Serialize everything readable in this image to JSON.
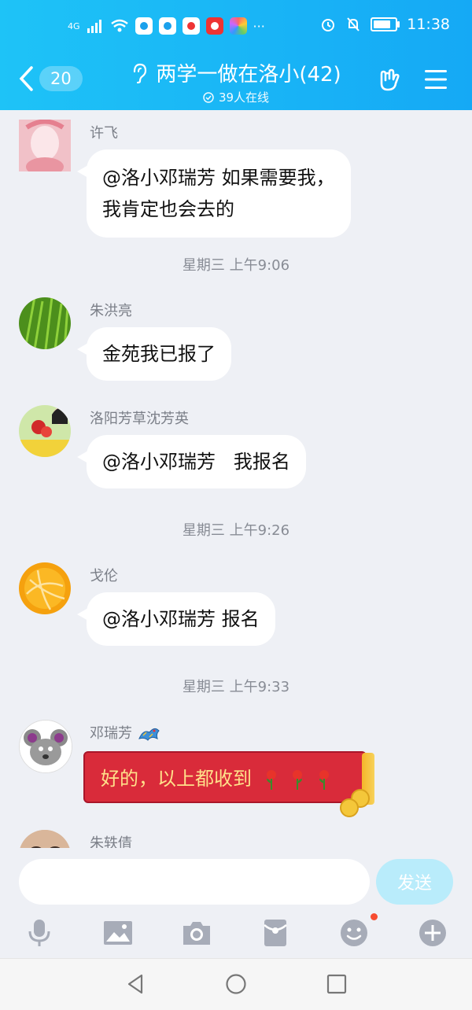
{
  "status_bar": {
    "network": "4G",
    "more": "···",
    "time": "11:38"
  },
  "header": {
    "back_count": "20",
    "group_name": "两学一做在洛小(42)",
    "online_status": "39人在线"
  },
  "messages": [
    {
      "sender": "许飞",
      "lines": [
        "@洛小邓瑞芳 如果需要我，",
        "我肯定也会去的"
      ]
    },
    {
      "timestamp": "星期三 上午9:06"
    },
    {
      "sender": "朱洪亮",
      "text": "金苑我已报了"
    },
    {
      "sender": "洛阳芳草沈芳英",
      "text": "@洛小邓瑞芳   我报名"
    },
    {
      "timestamp": "星期三 上午9:26"
    },
    {
      "sender": "戈伦",
      "text": "@洛小邓瑞芳 报名"
    },
    {
      "timestamp": "星期三 上午9:33"
    },
    {
      "sender": "邓瑞芳",
      "text": "好的，以上都收到"
    },
    {
      "sender": "朱轶倩"
    }
  ],
  "input": {
    "placeholder": "",
    "send_label": "发送"
  },
  "toolbar": {
    "items": [
      "mic-icon",
      "image-icon",
      "camera-icon",
      "red-packet-icon",
      "emoji-icon",
      "plus-icon"
    ]
  },
  "colors": {
    "header_start": "#1ec3f7",
    "header_end": "#15a9f5",
    "red_card": "#d92b3a"
  }
}
